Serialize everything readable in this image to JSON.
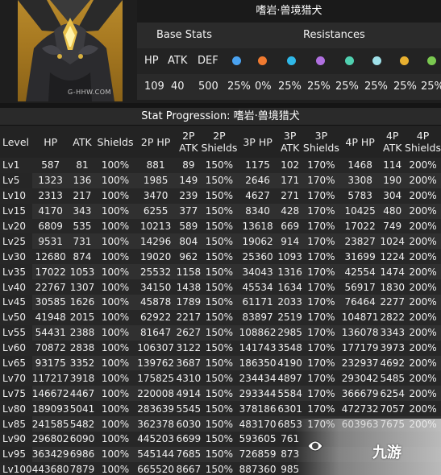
{
  "header": {
    "name": "嗜岩·兽境猎犬",
    "base_stats_label": "Base Stats",
    "resistances_label": "Resistances",
    "watermark": "G-HHW.COM"
  },
  "base_stats": {
    "labels": [
      "HP",
      "ATK",
      "DEF"
    ],
    "values": [
      "109",
      "40",
      "500"
    ]
  },
  "resistances": {
    "elements": [
      {
        "icon": "pyro-icon",
        "color": "#4aa2f0"
      },
      {
        "icon": "pyro-icon",
        "color": "#f07a30"
      },
      {
        "icon": "hydro-icon",
        "color": "#2fb8e8"
      },
      {
        "icon": "electro-icon",
        "color": "#b070e0"
      },
      {
        "icon": "anemo-icon",
        "color": "#50d0b0"
      },
      {
        "icon": "geo-icon",
        "color": "#e8b030"
      }
    ],
    "values": [
      "25%",
      "0%",
      "25%",
      "25%",
      "25%",
      "25%",
      "25%",
      "25%"
    ]
  },
  "progression": {
    "title": "Stat Progression: 嗜岩·兽境猎犬",
    "columns": [
      "Level",
      "HP",
      "ATK",
      "Shields",
      "2P HP",
      "2P ATK",
      "2P Shields",
      "3P HP",
      "3P ATK",
      "3P Shields",
      "4P HP",
      "4P ATK",
      "4P Shields"
    ],
    "rows": [
      [
        "Lv1",
        "587",
        "81",
        "100%",
        "881",
        "89",
        "150%",
        "1175",
        "102",
        "170%",
        "1468",
        "114",
        "200%"
      ],
      [
        "Lv5",
        "1323",
        "136",
        "100%",
        "1985",
        "149",
        "150%",
        "2646",
        "171",
        "170%",
        "3308",
        "190",
        "200%"
      ],
      [
        "Lv10",
        "2313",
        "217",
        "100%",
        "3470",
        "239",
        "150%",
        "4627",
        "271",
        "170%",
        "5783",
        "304",
        "200%"
      ],
      [
        "Lv15",
        "4170",
        "343",
        "100%",
        "6255",
        "377",
        "150%",
        "8340",
        "428",
        "170%",
        "10425",
        "480",
        "200%"
      ],
      [
        "Lv20",
        "6809",
        "535",
        "100%",
        "10213",
        "589",
        "150%",
        "13618",
        "669",
        "170%",
        "17022",
        "749",
        "200%"
      ],
      [
        "Lv25",
        "9531",
        "731",
        "100%",
        "14296",
        "804",
        "150%",
        "19062",
        "914",
        "170%",
        "23827",
        "1024",
        "200%"
      ],
      [
        "Lv30",
        "12680",
        "874",
        "100%",
        "19020",
        "962",
        "150%",
        "25360",
        "1093",
        "170%",
        "31699",
        "1224",
        "200%"
      ],
      [
        "Lv35",
        "17022",
        "1053",
        "100%",
        "25532",
        "1158",
        "150%",
        "34043",
        "1316",
        "170%",
        "42554",
        "1474",
        "200%"
      ],
      [
        "Lv40",
        "22767",
        "1307",
        "100%",
        "34150",
        "1438",
        "150%",
        "45534",
        "1634",
        "170%",
        "56917",
        "1830",
        "200%"
      ],
      [
        "Lv45",
        "30585",
        "1626",
        "100%",
        "45878",
        "1789",
        "150%",
        "61171",
        "2033",
        "170%",
        "76464",
        "2277",
        "200%"
      ],
      [
        "Lv50",
        "41948",
        "2015",
        "100%",
        "62922",
        "2217",
        "150%",
        "83897",
        "2519",
        "170%",
        "104871",
        "2822",
        "200%"
      ],
      [
        "Lv55",
        "54431",
        "2388",
        "100%",
        "81647",
        "2627",
        "150%",
        "108862",
        "2985",
        "170%",
        "136078",
        "3343",
        "200%"
      ],
      [
        "Lv60",
        "70872",
        "2838",
        "100%",
        "106307",
        "3122",
        "150%",
        "141743",
        "3548",
        "170%",
        "177179",
        "3973",
        "200%"
      ],
      [
        "Lv65",
        "93175",
        "3352",
        "100%",
        "139762",
        "3687",
        "150%",
        "186350",
        "4190",
        "170%",
        "232937",
        "4692",
        "200%"
      ],
      [
        "Lv70",
        "117217",
        "3918",
        "100%",
        "175825",
        "4310",
        "150%",
        "234434",
        "4897",
        "170%",
        "293042",
        "5485",
        "200%"
      ],
      [
        "Lv75",
        "146672",
        "4467",
        "100%",
        "220008",
        "4914",
        "150%",
        "293344",
        "5584",
        "170%",
        "366679",
        "6254",
        "200%"
      ],
      [
        "Lv80",
        "189093",
        "5041",
        "100%",
        "283639",
        "5545",
        "150%",
        "378186",
        "6301",
        "170%",
        "472732",
        "7057",
        "200%"
      ],
      [
        "Lv85",
        "241585",
        "5482",
        "100%",
        "362378",
        "6030",
        "150%",
        "483170",
        "6853",
        "170%",
        "603963",
        "7675",
        "200%"
      ],
      [
        "Lv90",
        "296802",
        "6090",
        "100%",
        "445203",
        "6699",
        "150%",
        "593605",
        "761",
        "",
        "",
        "",
        ""
      ],
      [
        "Lv95",
        "363429",
        "6986",
        "100%",
        "545144",
        "7685",
        "150%",
        "726859",
        "873",
        "",
        "",
        "",
        ""
      ],
      [
        "Lv100",
        "443680",
        "7879",
        "100%",
        "665520",
        "8667",
        "150%",
        "887360",
        "985",
        "",
        "",
        "",
        ""
      ]
    ]
  },
  "site_logo": {
    "text": "九游"
  }
}
